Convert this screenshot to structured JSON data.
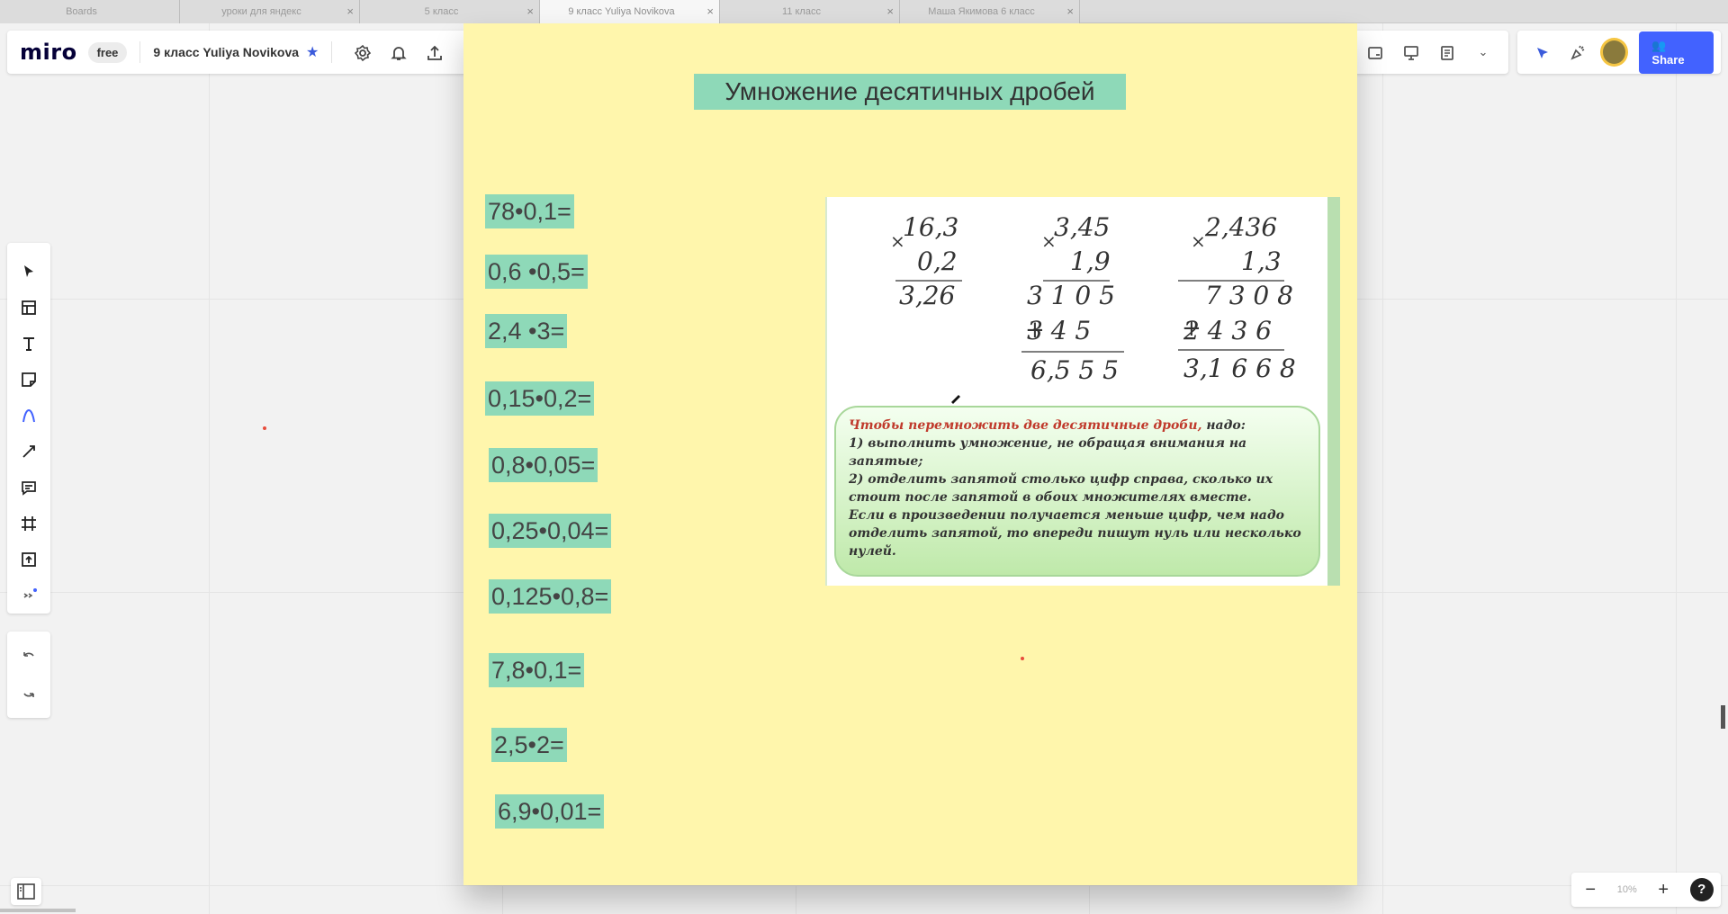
{
  "tabs": [
    {
      "label": "Boards"
    },
    {
      "label": "уроки для яндекс"
    },
    {
      "label": "5 класс"
    },
    {
      "label": "9 класс Yuliya Novikova",
      "active": true
    },
    {
      "label": "11 класс"
    },
    {
      "label": "Маша Якимова 6 класс"
    }
  ],
  "top_left": {
    "logo": "miro",
    "plan": "free",
    "board_name": "9 класс Yuliya Novikova"
  },
  "top_right": {
    "share_label": "Share"
  },
  "board": {
    "title": "Умножение десятичных дробей",
    "exercises": [
      "78•0,1=",
      "0,6 •0,5=",
      "2,4 •3=",
      "0,15•0,2=",
      "0,8•0,05=",
      "0,25•0,04=",
      "0,125•0,8=",
      "7,8•0,1=",
      "2,5•2=",
      "6,9•0,01="
    ],
    "textbook": {
      "examples": [
        {
          "a": "16,3",
          "b": "0,2",
          "partials": [],
          "result": "3,26"
        },
        {
          "a": "3,45",
          "b": "1,9",
          "partials": [
            "3 1 0 5",
            "3 4 5"
          ],
          "result": "6,5 5 5"
        },
        {
          "a": "2,436",
          "b": "1,3",
          "partials": [
            "7 3 0 8",
            "2 4 3 6"
          ],
          "result": "3,1 6 6 8"
        }
      ],
      "rule_intro_red": "Чтобы перемножить две десятичные дроби,",
      "rule_intro_tail": " надо:",
      "rule_lines": [
        "1) выполнить умножение, не обращая внимания на запятые;",
        "2) отделить запятой столько цифр справа, сколько их стоит после запятой в обоих множителях вместе.",
        "Если в произведении получается меньше цифр, чем надо отделить запятой, то впереди пишут нуль или несколько нулей."
      ]
    }
  },
  "zoom": {
    "level": "10%",
    "help": "?"
  }
}
